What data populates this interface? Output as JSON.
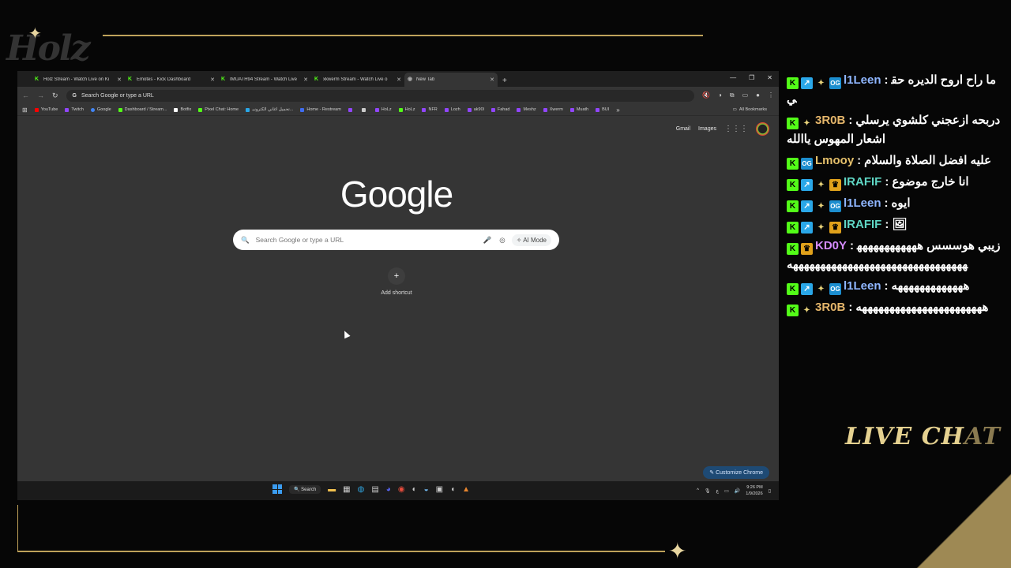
{
  "overlay": {
    "logo_text": "Holz",
    "live_chat_label_a": "LIVE CH",
    "live_chat_label_b": "AT"
  },
  "tabs": [
    {
      "title": "Holz Stream - Watch Live on Ki",
      "active": false
    },
    {
      "title": "Emotes - Kick Dashboard",
      "active": false
    },
    {
      "title": "IMUATH94 Stream - Watch Live",
      "active": false
    },
    {
      "title": "xkwerm Stream - Watch Live o",
      "active": false
    },
    {
      "title": "New Tab",
      "active": true
    }
  ],
  "omnibox": {
    "placeholder": "Search Google or type a URL"
  },
  "bookmarks": [
    {
      "label": "YouTube",
      "color": "#ff0000"
    },
    {
      "label": "Twitch",
      "color": "#9146ff"
    },
    {
      "label": "Google",
      "color": "#4285f4"
    },
    {
      "label": "Dashboard / Stream...",
      "color": "#53fc18"
    },
    {
      "label": "Botfix",
      "color": "#ffffff"
    },
    {
      "label": "Pixel Chat: Home",
      "color": "#53fc18"
    },
    {
      "label": "تحميل اغاني الكترونيـ...",
      "color": "#2aa7e8"
    },
    {
      "label": "Home - Restream",
      "color": "#3f6cf0"
    },
    {
      "label": "",
      "color": "#9146ff"
    },
    {
      "label": "",
      "color": "#cccccc"
    },
    {
      "label": "HoLz",
      "color": "#9146ff"
    },
    {
      "label": "HoLz",
      "color": "#53fc18"
    },
    {
      "label": "NFR",
      "color": "#9146ff"
    },
    {
      "label": "Lozh",
      "color": "#9146ff"
    },
    {
      "label": "ak90l",
      "color": "#9146ff"
    },
    {
      "label": "Fahad",
      "color": "#9146ff"
    },
    {
      "label": "Meshz",
      "color": "#9146ff"
    },
    {
      "label": "Xwerm",
      "color": "#9146ff"
    },
    {
      "label": "Muath",
      "color": "#9146ff"
    },
    {
      "label": "BUI",
      "color": "#9146ff"
    }
  ],
  "all_bookmarks": "All Bookmarks",
  "ntp": {
    "gmail": "Gmail",
    "images": "Images",
    "logo": "Google",
    "search_placeholder": "Search Google or type a URL",
    "ai_mode": "AI Mode",
    "add_shortcut": "Add shortcut",
    "customize": "Customize Chrome"
  },
  "taskbar": {
    "search": "Search",
    "time": "9:26 PM",
    "date": "1/9/2026",
    "lang": "ع"
  },
  "chat": [
    {
      "badges": [
        "k",
        "arrow",
        "star",
        "og"
      ],
      "user": "l1Leen",
      "color": "#8fb6ff",
      "text": "ما راح اروح الديره حقي"
    },
    {
      "badges": [
        "k",
        "star"
      ],
      "user": "3R0B",
      "color": "#e5b66b",
      "text": "دربحه ازعجني كلشوي يرسلي اشعار المهوس ياالله"
    },
    {
      "badges": [
        "k",
        "og"
      ],
      "user": "Lmooy",
      "color": "#e5c06b",
      "text": "عليه افضل الصلاة والسلام"
    },
    {
      "badges": [
        "k",
        "arrow",
        "star",
        "crown"
      ],
      "user": "IRAFIF",
      "color": "#5fd6c4",
      "text": "انا خارج موضوع"
    },
    {
      "badges": [
        "k",
        "arrow",
        "star",
        "og"
      ],
      "user": "l1Leen",
      "color": "#8fb6ff",
      "text": "ايوه"
    },
    {
      "badges": [
        "k",
        "arrow",
        "star",
        "crown"
      ],
      "user": "IRAFIF",
      "color": "#5fd6c4",
      "text": "🖼"
    },
    {
      "badges": [
        "k",
        "crown"
      ],
      "user": "KD0Y",
      "color": "#d58bff",
      "text": "زيبي هوسسس ههههههههههههههههههههههههههههههههههههههههههههه"
    },
    {
      "badges": [
        "k",
        "arrow",
        "star",
        "og"
      ],
      "user": "l1Leen",
      "color": "#8fb6ff",
      "text": "هههههههههههههه"
    },
    {
      "badges": [
        "k",
        "star"
      ],
      "user": "3R0B",
      "color": "#e5b66b",
      "text": "هههههههههههههههههههههههه"
    }
  ]
}
